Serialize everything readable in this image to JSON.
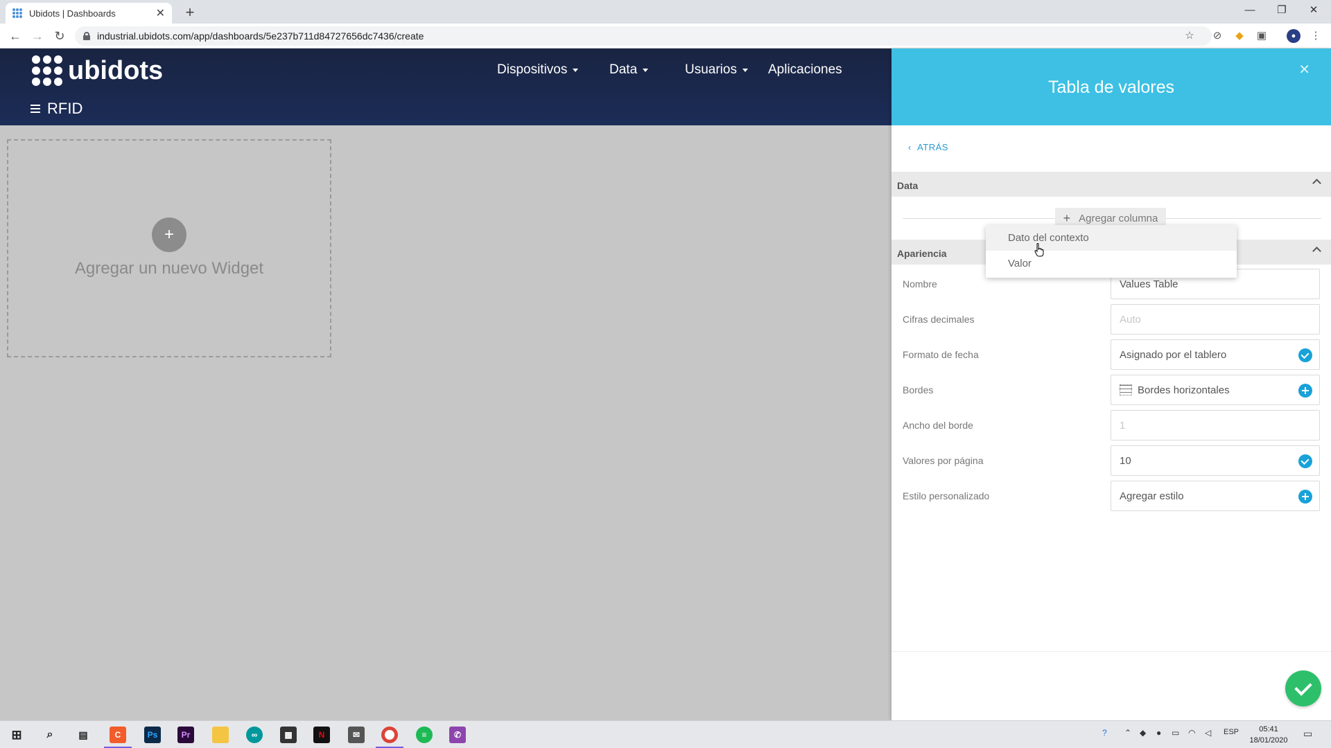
{
  "browser": {
    "tab_title": "Ubidots | Dashboards",
    "url": "industrial.ubidots.com/app/dashboards/5e237b711d84727656dc7436/create"
  },
  "app": {
    "brand": "ubidots",
    "nav": [
      "Dispositivos",
      "Data",
      "Usuarios",
      "Aplicaciones"
    ],
    "dashboard_name": "RFID",
    "add_widget_label": "Agregar un nuevo Widget"
  },
  "panel": {
    "title": "Tabla de valores",
    "back_label": "ATRÁS",
    "data_section": "Data",
    "add_column_label": "Agregar columna",
    "appearance_section": "Apariencia",
    "dropdown_items": [
      "Dato del contexto",
      "Valor"
    ],
    "fields": {
      "name_label": "Nombre",
      "name_value": "Values Table",
      "decimals_label": "Cifras decimales",
      "decimals_placeholder": "Auto",
      "date_format_label": "Formato de fecha",
      "date_format_value": "Asignado por el tablero",
      "borders_label": "Bordes",
      "borders_value": "Bordes horizontales",
      "border_width_label": "Ancho del borde",
      "border_width_placeholder": "1",
      "per_page_label": "Valores por página",
      "per_page_value": "10",
      "custom_style_label": "Estilo personalizado",
      "custom_style_value": "Agregar estilo"
    }
  },
  "taskbar": {
    "lang": "ESP",
    "time": "05:41",
    "date": "18/01/2020"
  },
  "colors": {
    "header_dark": "#1b2c57",
    "panel_accent": "#3dc0e3",
    "link_blue": "#2b9ad0",
    "confirm_green": "#2ebf6a"
  }
}
